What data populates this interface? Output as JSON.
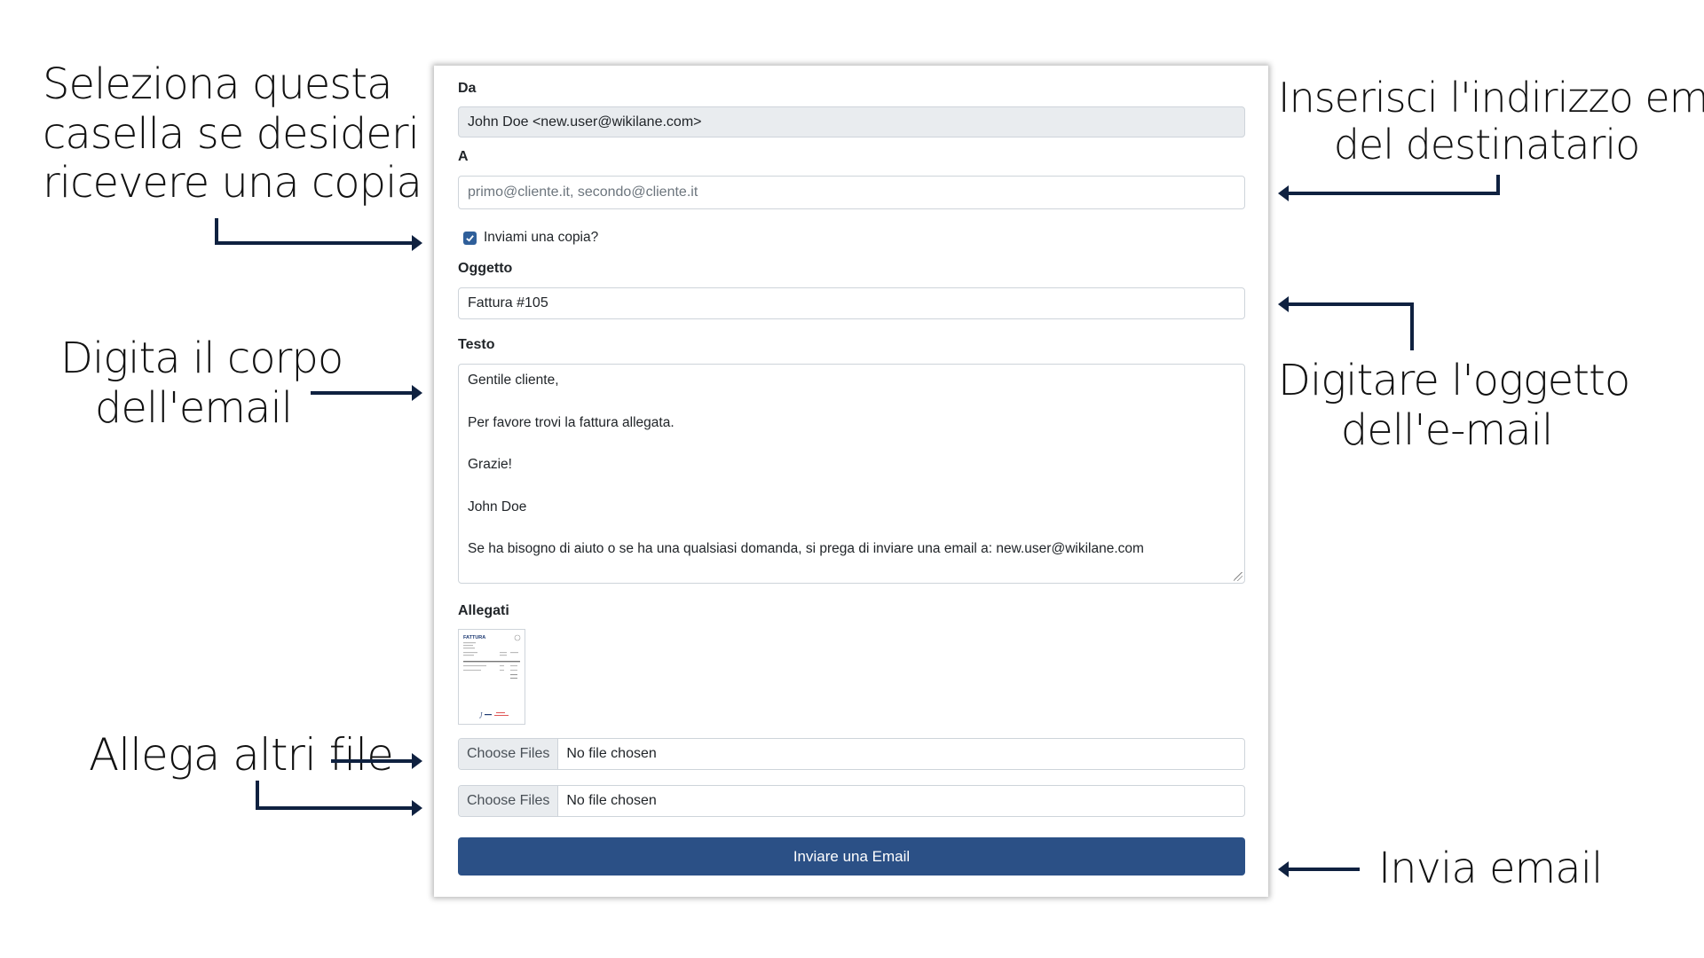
{
  "annotations": {
    "copy": [
      "Seleziona questa",
      "casella se desideri",
      "ricevere una copia"
    ],
    "body": [
      "Digita il corpo",
      "dell'email"
    ],
    "attach": [
      "Allega altri file"
    ],
    "recipient": [
      "Inserisci l'indirizzo email",
      "del destinatario"
    ],
    "subject": [
      "Digitare l'oggetto",
      "dell'e-mail"
    ],
    "send": [
      "Invia email"
    ]
  },
  "form": {
    "from_label": "Da",
    "from_value": "John Doe <new.user@wikilane.com>",
    "to_label": "A",
    "to_placeholder": "primo@cliente.it, secondo@cliente.it",
    "copy_label": "Inviami una copia?",
    "copy_checked": true,
    "subject_label": "Oggetto",
    "subject_value": "Fattura #105",
    "body_label": "Testo",
    "body_lines": [
      "Gentile cliente,",
      "Per favore trovi la fattura allegata.",
      "Grazie!",
      "John Doe",
      "Se ha bisogno di aiuto o se ha una qualsiasi domanda, si prega di inviare una email a: new.user@wikilane.com"
    ],
    "attachments_label": "Allegati",
    "attachment_thumb_title": "FATTURA",
    "file_inputs": [
      {
        "button": "Choose Files",
        "status": "No file chosen"
      },
      {
        "button": "Choose Files",
        "status": "No file chosen"
      }
    ],
    "submit_label": "Inviare una Email"
  },
  "colors": {
    "arrow": "#0f2140",
    "primary": "#2b5086",
    "readonly_bg": "#e9ecef"
  }
}
